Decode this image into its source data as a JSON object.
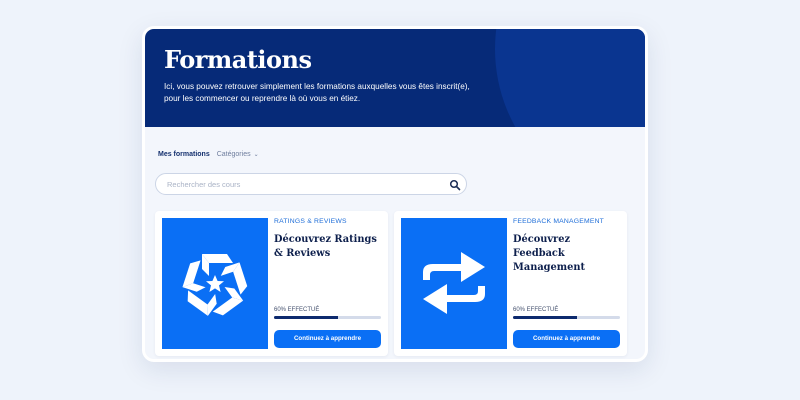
{
  "hero": {
    "title": "Formations",
    "description": "Ici, vous pouvez retrouver simplement les formations auxquelles vous êtes inscrit(e), pour les commencer ou reprendre là où vous en étiez."
  },
  "tabs": {
    "active": "Mes formations",
    "categories": "Catégories"
  },
  "search": {
    "placeholder": "Rechercher des cours",
    "icon": "search-icon"
  },
  "courses": [
    {
      "category": "RATINGS & REVIEWS",
      "title": "Découvrez Ratings & Reviews",
      "progress_label": "60% EFFECTUÉ",
      "progress": 0.6,
      "cta": "Continuez à apprendre",
      "icon": "star-swirl-icon"
    },
    {
      "category": "FEEDBACK MANAGEMENT",
      "title": "Découvrez Feedback Management",
      "progress_label": "60% EFFECTUÉ",
      "progress": 0.6,
      "cta": "Continuez à apprendre",
      "icon": "swap-arrows-icon"
    }
  ],
  "colors": {
    "hero_bg": "#062a78",
    "accent": "#0a6ff5",
    "progress": "#0d2a6e"
  }
}
